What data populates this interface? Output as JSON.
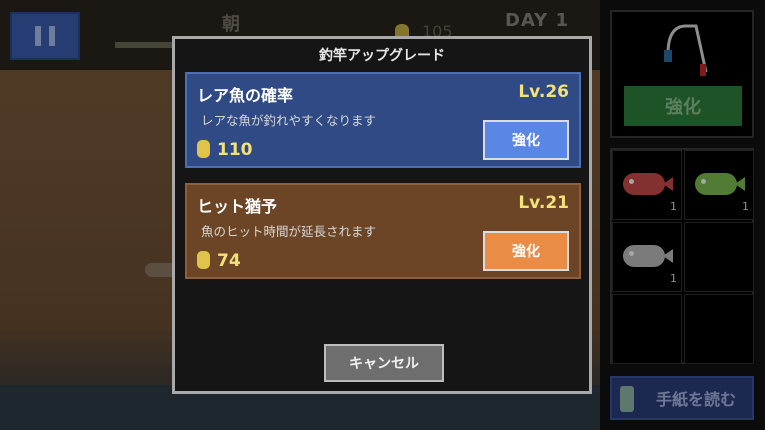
{
  "hud": {
    "pause_icon": "pause-icon",
    "time_of_day": "朝",
    "coin_count": "105",
    "day": "DAY 1"
  },
  "side_panel": {
    "rod_icon": "fishing-rod-icon",
    "enhance_label": "強化",
    "inventory": [
      {
        "icon": "red-fish-icon",
        "color": "#c94a4a",
        "count": "1"
      },
      {
        "icon": "green-fish-icon",
        "color": "#7fbf52",
        "count": "1"
      },
      {
        "icon": "gray-fish-icon",
        "color": "#bdbdbd",
        "count": "1"
      }
    ],
    "guide_label": "手紙を読む",
    "guide_icon": "bottle-icon"
  },
  "modal": {
    "title": "釣竿アップグレード",
    "upgrades": [
      {
        "name": "レア魚の確率",
        "level": "Lv.26",
        "description": "レアな魚が釣れやすくなります",
        "cost": "110",
        "button": "強化",
        "accent": "#5a86e6"
      },
      {
        "name": "ヒット猶予",
        "level": "Lv.21",
        "description": "魚のヒット時間が延長されます",
        "cost": "74",
        "button": "強化",
        "accent": "#e98d46"
      }
    ],
    "cancel_label": "キャンセル"
  }
}
